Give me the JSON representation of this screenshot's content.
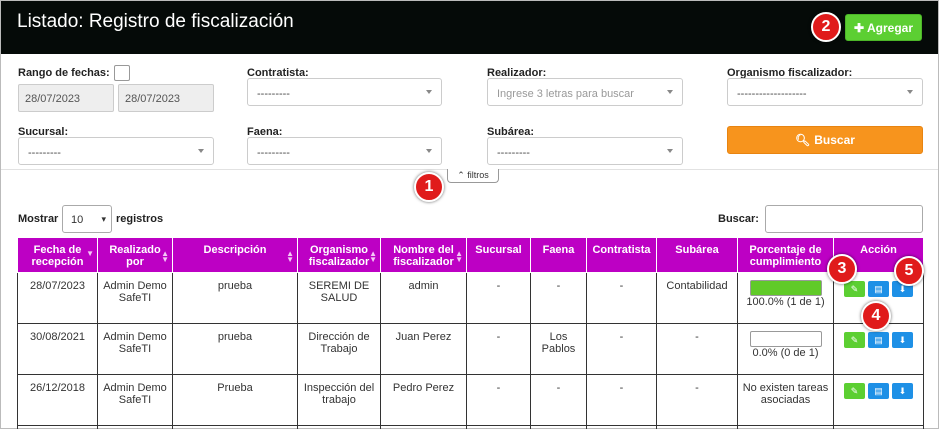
{
  "header": {
    "title": "Listado: Registro de fiscalización",
    "add_label": "Agregar"
  },
  "filters": {
    "date_range_label": "Rango de fechas:",
    "date_from": "28/07/2023",
    "date_to": "28/07/2023",
    "contratista": {
      "label": "Contratista:",
      "value": "---------"
    },
    "realizador": {
      "label": "Realizador:",
      "placeholder": "Ingrese 3 letras para buscar"
    },
    "organismo": {
      "label": "Organismo fiscalizador:",
      "value": "-------------------"
    },
    "sucursal": {
      "label": "Sucursal:",
      "value": "---------"
    },
    "faena": {
      "label": "Faena:",
      "value": "---------"
    },
    "subarea": {
      "label": "Subárea:",
      "value": "---------"
    },
    "search_button": "Buscar",
    "toggle_label": "filtros"
  },
  "table_controls": {
    "show_label": "Mostrar",
    "page_length": "10",
    "records_label": "registros",
    "search_label": "Buscar:"
  },
  "table": {
    "headers": [
      "Fecha de recepción",
      "Realizado por",
      "Descripción",
      "Organismo fiscalizador",
      "Nombre del fiscalizador",
      "Sucursal",
      "Faena",
      "Contratista",
      "Subárea",
      "Porcentaje de cumplimiento",
      "Acción"
    ],
    "rows": [
      {
        "fecha": "28/07/2023",
        "realizado": "Admin Demo SafeTI",
        "descripcion": "prueba",
        "organismo": "SEREMI DE SALUD",
        "fiscalizador": "admin",
        "sucursal": "-",
        "faena": "-",
        "contratista": "-",
        "subarea": "Contabilidad",
        "progress": 1.0,
        "progress_text": "100.0% (1 de 1)"
      },
      {
        "fecha": "30/08/2021",
        "realizado": "Admin Demo SafeTI",
        "descripcion": "prueba",
        "organismo": "Dirección de Trabajo",
        "fiscalizador": "Juan Perez",
        "sucursal": "-",
        "faena": "Los Pablos",
        "contratista": "-",
        "subarea": "-",
        "progress": 0.0,
        "progress_text": "0.0% (0 de 1)"
      },
      {
        "fecha": "26/12/2018",
        "realizado": "Admin Demo SafeTI",
        "descripcion": "Prueba",
        "organismo": "Inspección del trabajo",
        "fiscalizador": "Pedro Perez",
        "sucursal": "-",
        "faena": "-",
        "contratista": "-",
        "subarea": "-",
        "progress_text": "No existen tareas asociadas"
      }
    ]
  },
  "annotations": [
    "1",
    "2",
    "3",
    "4",
    "5"
  ],
  "colors": {
    "header_bg": "#050a08",
    "table_header": "#bd00c4",
    "add_button": "#5ccf32",
    "search_button": "#f7941d",
    "badge": "#e01b1b",
    "action_blue": "#1e90e6",
    "progress_fill": "#60ca28"
  }
}
